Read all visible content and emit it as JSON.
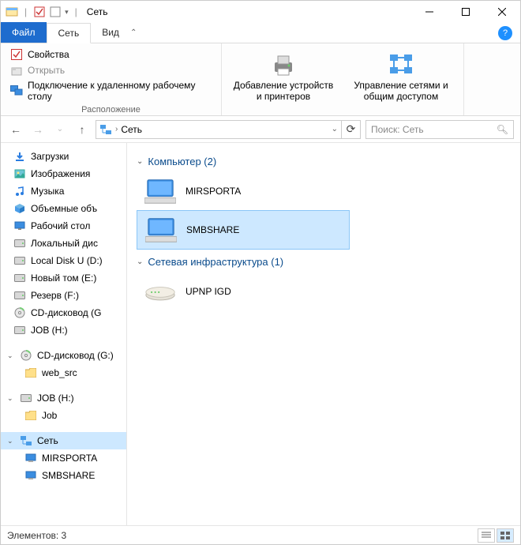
{
  "window": {
    "title": "Сеть"
  },
  "tabs": {
    "file": "Файл",
    "network": "Сеть",
    "view": "Вид"
  },
  "ribbon": {
    "properties": "Свойства",
    "open": "Открыть",
    "remote_desktop": "Подключение к удаленному рабочему столу",
    "group_location": "Расположение",
    "add_devices": "Добавление устройств и принтеров",
    "manage_networks": "Управление сетями и общим доступом"
  },
  "nav": {
    "breadcrumb": "Сеть",
    "search_placeholder": "Поиск: Сеть"
  },
  "sidebar": {
    "items": [
      {
        "label": "Загрузки",
        "icon": "downloads"
      },
      {
        "label": "Изображения",
        "icon": "pictures"
      },
      {
        "label": "Музыка",
        "icon": "music"
      },
      {
        "label": "Объемные объ",
        "icon": "3d"
      },
      {
        "label": "Рабочий стол",
        "icon": "desktop"
      },
      {
        "label": "Локальный дис",
        "icon": "drive"
      },
      {
        "label": "Local Disk U (D:)",
        "icon": "drive"
      },
      {
        "label": "Новый том (Е:)",
        "icon": "drive"
      },
      {
        "label": "Резерв (F:)",
        "icon": "drive"
      },
      {
        "label": "CD-дисковод (G",
        "icon": "cd"
      },
      {
        "label": "JOB (H:)",
        "icon": "drive"
      }
    ],
    "cd_expanded": {
      "label": "CD-дисковод (G:)",
      "icon": "cd"
    },
    "cd_child": {
      "label": "web_src",
      "icon": "folder"
    },
    "job_expanded": {
      "label": "JOB (H:)",
      "icon": "drive"
    },
    "job_child": {
      "label": "Job",
      "icon": "folder"
    },
    "network": {
      "label": "Сеть",
      "icon": "network"
    },
    "network_children": [
      {
        "label": "MIRSPORTA",
        "icon": "computer"
      },
      {
        "label": "SMBSHARE",
        "icon": "computer"
      }
    ]
  },
  "content": {
    "group_computer": "Компьютер (2)",
    "computers": [
      {
        "name": "MIRSPORTA"
      },
      {
        "name": "SMBSHARE"
      }
    ],
    "group_infra": "Сетевая инфраструктура (1)",
    "infra": [
      {
        "name": "UPNP IGD"
      }
    ]
  },
  "statusbar": {
    "elements": "Элементов: 3"
  }
}
